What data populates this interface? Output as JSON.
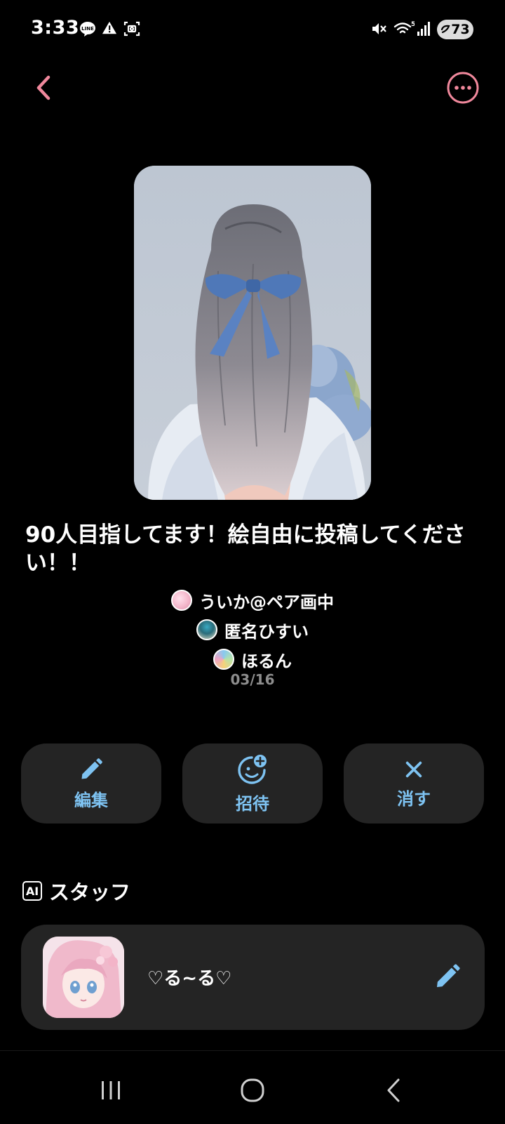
{
  "status_bar": {
    "time": "3:33",
    "battery_level": "73",
    "icons": [
      "line-icon",
      "alert-icon",
      "screenshot-icon",
      "mute-icon",
      "wifi-icon",
      "signal-icon",
      "battery-icon"
    ]
  },
  "header": {
    "back_icon": "chevron-left-icon",
    "more_icon": "more-horizontal-icon"
  },
  "post": {
    "title": "90人目指してます！絵自由に投稿してください！！",
    "members": [
      {
        "name": "ういか@ペア画中"
      },
      {
        "name": "匿名ひすい"
      },
      {
        "name": "ほるん"
      }
    ],
    "date": "03/16"
  },
  "actions": [
    {
      "label": "編集",
      "icon": "pencil-icon"
    },
    {
      "label": "招待",
      "icon": "invite-icon"
    },
    {
      "label": "消す",
      "icon": "close-icon"
    }
  ],
  "staff": {
    "badge": "AI",
    "heading": "スタッフ",
    "name": "♡る~る♡"
  },
  "colors": {
    "accent_pink": "#f0889c",
    "accent_blue": "#7ec3f2",
    "card_bg": "#242424",
    "date_gray": "#8d8d8d"
  },
  "nav": {
    "icons": [
      "recent-apps-icon",
      "home-icon",
      "back-nav-icon"
    ]
  }
}
